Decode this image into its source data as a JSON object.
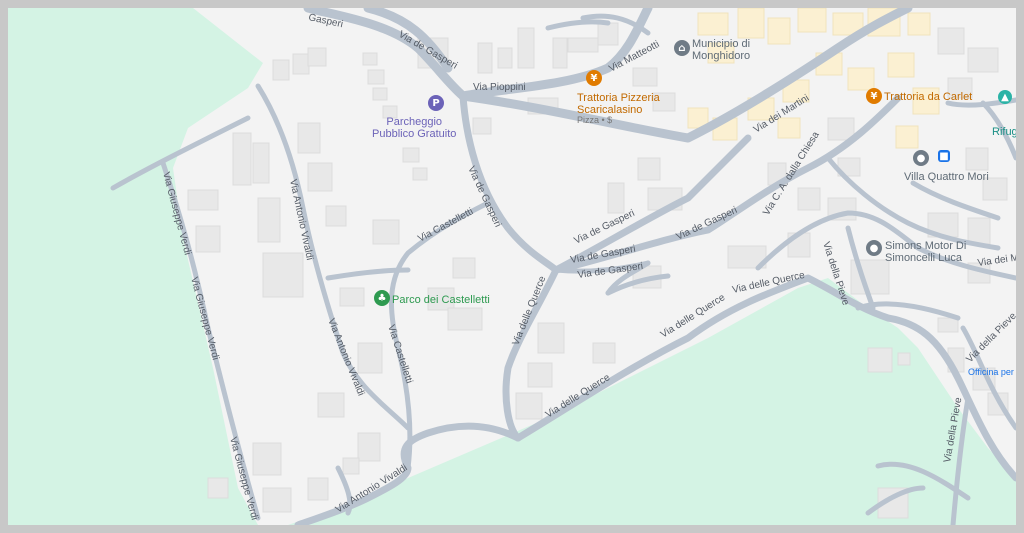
{
  "colors": {
    "frame": "#c8c8c8",
    "map_bg": "#f3f3f3",
    "park": "#d4f3e4",
    "road": "#b9c3cf",
    "building": "#e8e8e8",
    "building_center": "#fbf0d2",
    "food_poi": "#e07b00",
    "parking_poi": "#6c63b8",
    "park_poi": "#2e9a50",
    "gray_poi": "#6f7b86",
    "blue_poi": "#1a73e8"
  },
  "streets": {
    "giuseppe_verdi_1": "Via Giuseppe Verdi",
    "giuseppe_verdi_2": "Via Giuseppe Verdi",
    "giuseppe_verdi_3": "Via Giuseppe Verdi",
    "antonio_vivaldi_1": "Via Antonio Vivaldi",
    "antonio_vivaldi_2": "Via Antonio Vivaldi",
    "antonio_vivaldi_3": "Via Antonio Vivaldi",
    "castelletti_1": "Via Castelletti",
    "castelletti_2": "Via Castelletti",
    "de_gasperi_1": "Via de Gasperi",
    "de_gasperi_2": "Via de Gasperi",
    "de_gasperi_3": "Via de Gasperi",
    "de_gasperi_4": "Via de Gasperi",
    "de_gasperi_5": "Via de Gasperi",
    "de_gasperi_6": "Via de Gasperi",
    "de_gasperi_top": "Gasperi",
    "pioppini": "Via Pioppini",
    "matteotti": "Via Matteotti",
    "martini": "Via dei Martini",
    "chiesa": "Via C. A. dalla Chiesa",
    "querce_1": "Via delle Querce",
    "querce_2": "Via delle Querce",
    "querce_3": "Via delle Querce",
    "querce_4": "Via delle Querce",
    "pieve_1": "Via della Pieve",
    "pieve_2": "Via della Pieve",
    "pieve_3": "Via della Pieve",
    "via_dei_mol": "Via dei Mol"
  },
  "pois": {
    "municipio": "Municipio di\nMonghidoro",
    "trattoria_pizzeria": "Trattoria Pizzeria\nScaricalasino",
    "trattoria_sub": "Pizza • $",
    "trattoria_carlet": "Trattoria da Carlet",
    "parcheggio": "Parcheggio\nPubblico Gratuito",
    "villa": "Villa Quattro Mori",
    "simons": "Simons Motor Di\nSimoncelli Luca",
    "parco": "Parco dei Castelletti",
    "rifugio": "Rifug",
    "officina": "Officina per l"
  },
  "icons": {
    "parking": "P",
    "food": "fork-knife-icon",
    "park": "tree-icon",
    "building": "municipio-icon",
    "camera": "camera-icon",
    "bus": "bus-icon",
    "pin": "map-pin-icon",
    "mountain": "hut-icon"
  }
}
